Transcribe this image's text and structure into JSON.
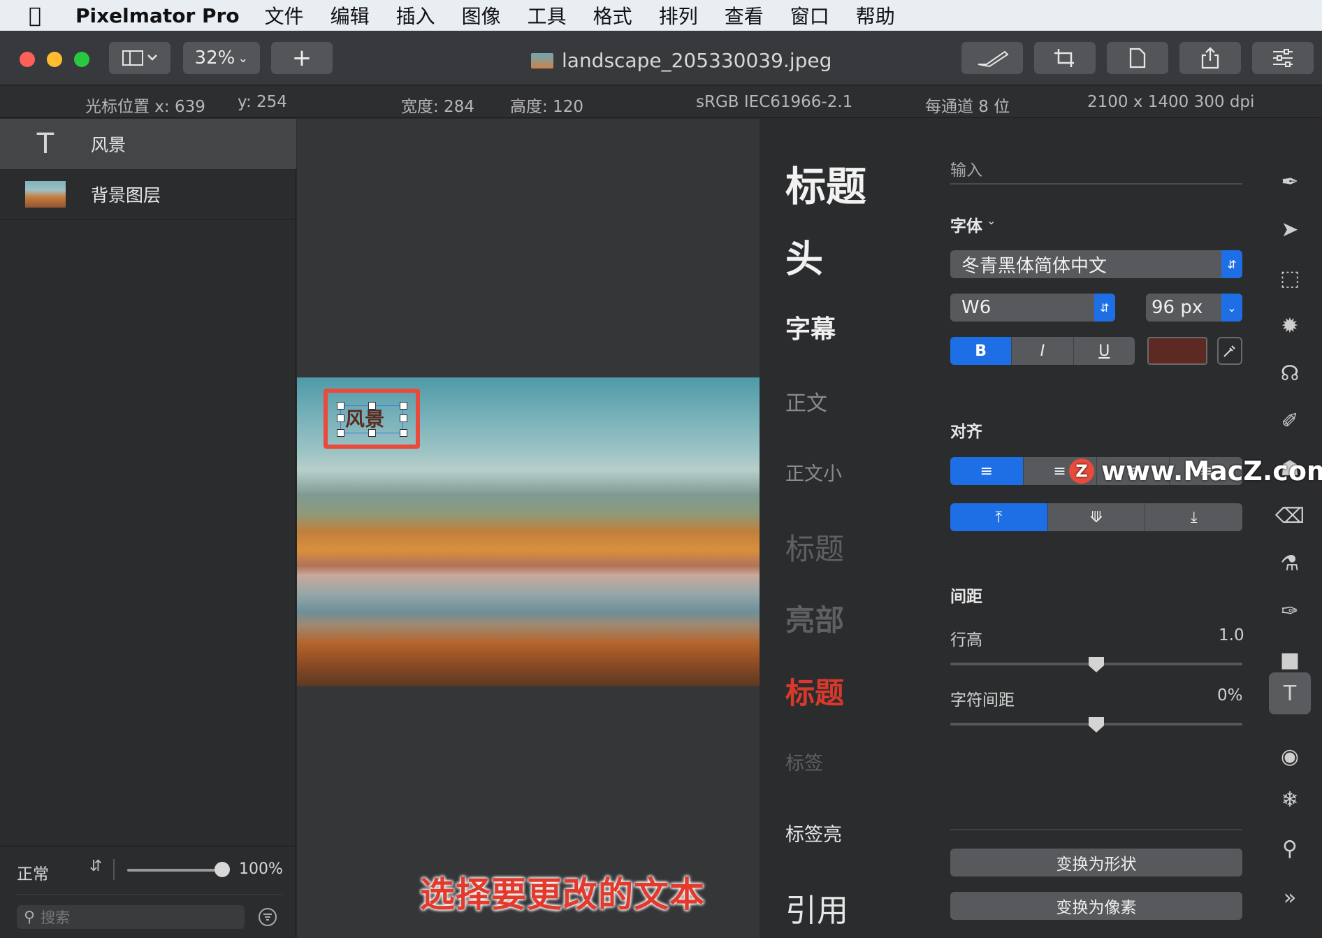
{
  "menubar": {
    "app": "Pixelmator Pro",
    "items": [
      "文件",
      "编辑",
      "插入",
      "图像",
      "工具",
      "格式",
      "排列",
      "查看",
      "窗口",
      "帮助"
    ]
  },
  "toolbar": {
    "zoom": "32%",
    "add": "+",
    "file_name": "landscape_205330039.jpeg"
  },
  "infobar": {
    "cursor_x": "光标位置 x:  639",
    "cursor_y": "y:  254",
    "width": "宽度:  284",
    "height": "高度:  120",
    "color_profile": "sRGB IEC61966-2.1",
    "bits": "每通道 8 位",
    "dimensions": "2100 x 1400 300 dpi"
  },
  "layers": {
    "items": [
      {
        "label": "风景",
        "icon": "T"
      },
      {
        "label": "背景图层"
      }
    ],
    "blend_mode": "正常",
    "opacity": "100%",
    "opacity_level": 1.0,
    "search_placeholder": "搜索"
  },
  "canvas": {
    "text_layer_text": "风景",
    "caption": "选择要更改的文本"
  },
  "styles": [
    "标题",
    "头",
    "字幕",
    "正文",
    "正文小",
    "标题",
    "亮部",
    "标题",
    "标签",
    "标签亮",
    "引用"
  ],
  "inspector": {
    "input_placeholder": "输入",
    "font_label": "字体",
    "font_family": "冬青黑体简体中文",
    "font_weight": "W6",
    "font_size": "96 px",
    "bold": "B",
    "italic": "I",
    "underline": "U",
    "text_color": "#5c2a22",
    "align_label": "对齐",
    "spacing_label": "间距",
    "line_height_label": "行高",
    "line_height_value": "1.0",
    "char_spacing_label": "字符间距",
    "char_spacing_value": "0%",
    "convert_shape": "变换为形状",
    "convert_pixels": "变换为像素"
  },
  "watermark": {
    "logo": "Z",
    "text": "www.MacZ.com"
  },
  "colors": {
    "accent": "#1e6ee6",
    "highlight": "#e84b3c",
    "selected_style": "#d9392b"
  }
}
